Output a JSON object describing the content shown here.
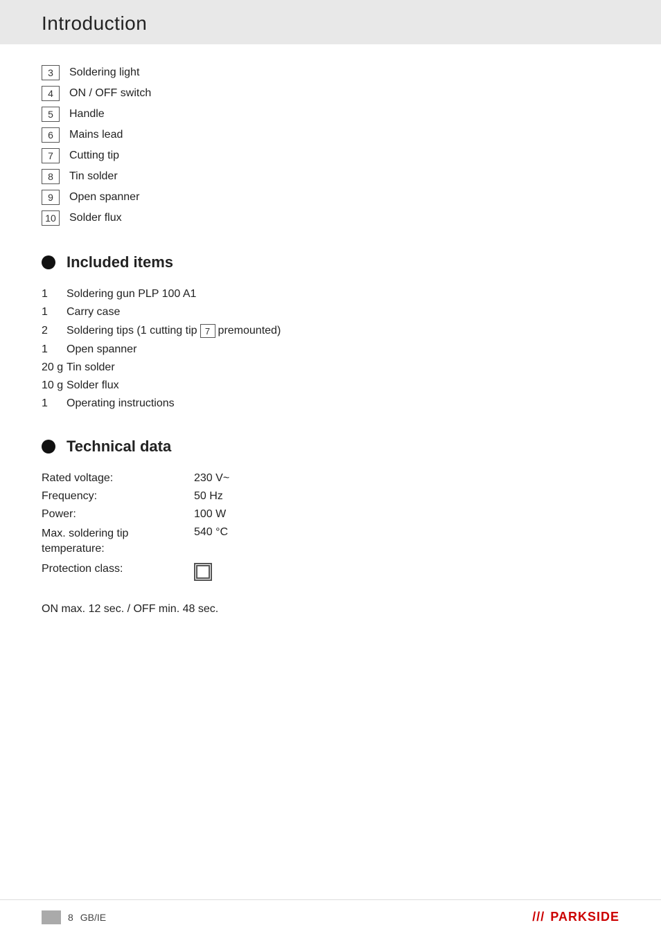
{
  "header": {
    "title": "Introduction"
  },
  "numbered_list": {
    "items": [
      {
        "num": "3",
        "label": "Soldering light"
      },
      {
        "num": "4",
        "label": "ON / OFF switch"
      },
      {
        "num": "5",
        "label": "Handle"
      },
      {
        "num": "6",
        "label": "Mains lead"
      },
      {
        "num": "7",
        "label": "Cutting tip"
      },
      {
        "num": "8",
        "label": "Tin solder"
      },
      {
        "num": "9",
        "label": "Open spanner"
      },
      {
        "num": "10",
        "label": "Solder flux"
      }
    ]
  },
  "included_items": {
    "heading": "Included items",
    "items": [
      {
        "qty": "1",
        "text": "Soldering gun PLP 100 A1",
        "badge": null
      },
      {
        "qty": "1",
        "text": "Carry case",
        "badge": null
      },
      {
        "qty": "2",
        "text_before": "Soldering tips (1  cutting tip",
        "badge": "7",
        "text_after": "premounted)",
        "has_badge": true
      },
      {
        "qty": "1",
        "text": "Open spanner",
        "badge": null
      },
      {
        "qty": "20 g",
        "text": "Tin solder",
        "badge": null
      },
      {
        "qty": "10 g",
        "text": "Solder flux",
        "badge": null
      },
      {
        "qty": "1",
        "text": "Operating instructions",
        "badge": null
      }
    ]
  },
  "technical_data": {
    "heading": "Technical data",
    "rows": [
      {
        "label": "Rated voltage:",
        "value": "230 V~"
      },
      {
        "label": "Frequency:",
        "value": "50 Hz"
      },
      {
        "label": "Power:",
        "value": "100 W"
      },
      {
        "label": "Max. soldering tip\ntemperature:",
        "value": "540 °C"
      },
      {
        "label": "Protection class:",
        "value": "icon"
      }
    ],
    "note": "ON max. 12 sec. / OFF min. 48 sec."
  },
  "footer": {
    "page_number": "8",
    "locale": "GB/IE",
    "brand": "PARKSIDE"
  }
}
